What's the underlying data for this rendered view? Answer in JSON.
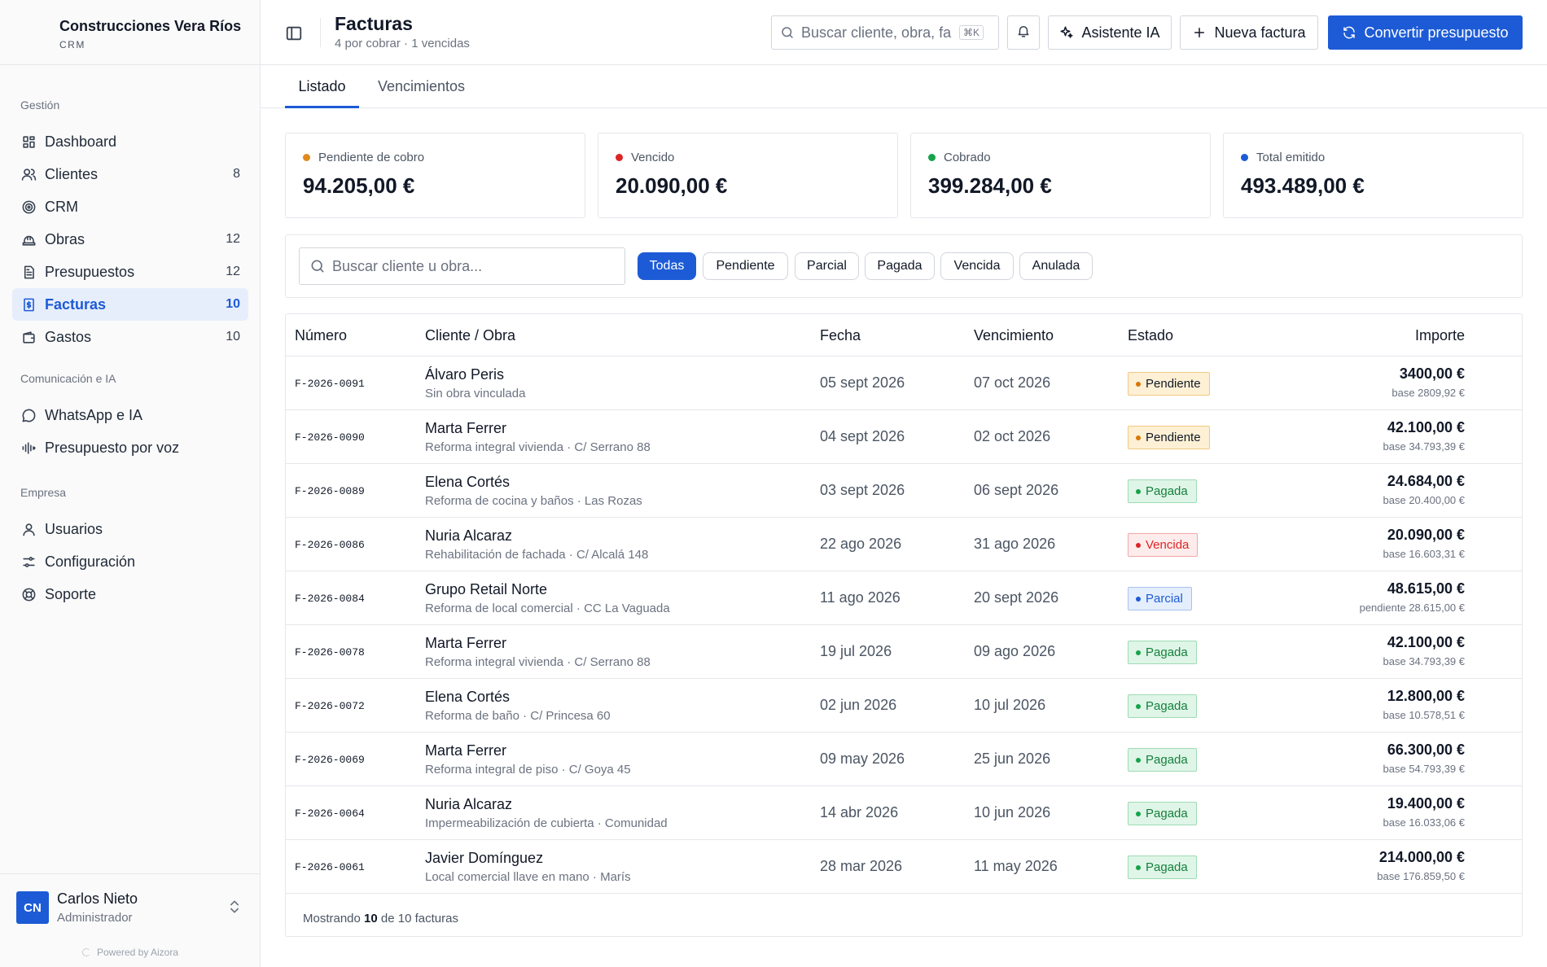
{
  "brand": {
    "name": "Construcciones Vera Ríos",
    "sub": "CRM"
  },
  "sidebar": {
    "groups": [
      {
        "title": "Gestión",
        "items": [
          {
            "label": "Dashboard",
            "icon": "dashboard-icon",
            "count": ""
          },
          {
            "label": "Clientes",
            "icon": "users-icon",
            "count": "8"
          },
          {
            "label": "CRM",
            "icon": "target-icon",
            "count": ""
          },
          {
            "label": "Obras",
            "icon": "helmet-icon",
            "count": "12"
          },
          {
            "label": "Presupuestos",
            "icon": "document-icon",
            "count": "12"
          },
          {
            "label": "Facturas",
            "icon": "invoice-icon",
            "count": "10",
            "active": true
          },
          {
            "label": "Gastos",
            "icon": "wallet-icon",
            "count": "10"
          }
        ]
      },
      {
        "title": "Comunicación e IA",
        "items": [
          {
            "label": "WhatsApp e IA",
            "icon": "chat-icon",
            "count": ""
          },
          {
            "label": "Presupuesto por voz",
            "icon": "waveform-icon",
            "count": ""
          }
        ]
      },
      {
        "title": "Empresa",
        "items": [
          {
            "label": "Usuarios",
            "icon": "user-icon",
            "count": ""
          },
          {
            "label": "Configuración",
            "icon": "sliders-icon",
            "count": ""
          },
          {
            "label": "Soporte",
            "icon": "lifebuoy-icon",
            "count": ""
          }
        ]
      }
    ]
  },
  "user": {
    "initials": "CN",
    "name": "Carlos Nieto",
    "role": "Administrador"
  },
  "powered_by": "Powered by Aizora",
  "header": {
    "title": "Facturas",
    "subtitle": "4 por cobrar · 1 vencidas",
    "search_placeholder": "Buscar cliente, obra, fa",
    "search_shortcut": "⌘K",
    "assistant_label": "Asistente IA",
    "new_invoice_label": "Nueva factura",
    "convert_label": "Convertir presupuesto"
  },
  "tabs": [
    {
      "label": "Listado",
      "active": true
    },
    {
      "label": "Vencimientos",
      "active": false
    }
  ],
  "stats": [
    {
      "label": "Pendiente de cobro",
      "value": "94.205,00 €",
      "color": "#e08a1e"
    },
    {
      "label": "Vencido",
      "value": "20.090,00 €",
      "color": "#dc2626"
    },
    {
      "label": "Cobrado",
      "value": "399.284,00 €",
      "color": "#16a34a"
    },
    {
      "label": "Total emitido",
      "value": "493.489,00 €",
      "color": "#1d5bd6"
    }
  ],
  "filters": {
    "search_placeholder": "Buscar cliente u obra...",
    "chips": [
      {
        "label": "Todas",
        "active": true
      },
      {
        "label": "Pendiente",
        "active": false
      },
      {
        "label": "Parcial",
        "active": false
      },
      {
        "label": "Pagada",
        "active": false
      },
      {
        "label": "Vencida",
        "active": false
      },
      {
        "label": "Anulada",
        "active": false
      }
    ]
  },
  "table": {
    "columns": [
      "Número",
      "Cliente / Obra",
      "Fecha",
      "Vencimiento",
      "Estado",
      "Importe"
    ],
    "rows": [
      {
        "number": "F-2026-0091",
        "client": "Álvaro Peris",
        "obra": "Sin obra vinculada",
        "date": "05 sept 2026",
        "due": "07 oct 2026",
        "status": "Pendiente",
        "status_key": "pendiente",
        "amount": "3400,00 €",
        "base": "base 2809,92 €"
      },
      {
        "number": "F-2026-0090",
        "client": "Marta Ferrer",
        "obra": "Reforma integral vivienda · C/ Serrano 88",
        "date": "04 sept 2026",
        "due": "02 oct 2026",
        "status": "Pendiente",
        "status_key": "pendiente",
        "amount": "42.100,00 €",
        "base": "base 34.793,39 €"
      },
      {
        "number": "F-2026-0089",
        "client": "Elena Cortés",
        "obra": "Reforma de cocina y baños · Las Rozas",
        "date": "03 sept 2026",
        "due": "06 sept 2026",
        "status": "Pagada",
        "status_key": "pagada",
        "amount": "24.684,00 €",
        "base": "base 20.400,00 €"
      },
      {
        "number": "F-2026-0086",
        "client": "Nuria Alcaraz",
        "obra": "Rehabilitación de fachada · C/ Alcalá 148",
        "date": "22 ago 2026",
        "due": "31 ago 2026",
        "status": "Vencida",
        "status_key": "vencida",
        "amount": "20.090,00 €",
        "base": "base 16.603,31 €"
      },
      {
        "number": "F-2026-0084",
        "client": "Grupo Retail Norte",
        "obra": "Reforma de local comercial · CC La Vaguada",
        "date": "11 ago 2026",
        "due": "20 sept 2026",
        "status": "Parcial",
        "status_key": "parcial",
        "amount": "48.615,00 €",
        "base": "pendiente 28.615,00 €"
      },
      {
        "number": "F-2026-0078",
        "client": "Marta Ferrer",
        "obra": "Reforma integral vivienda · C/ Serrano 88",
        "date": "19 jul 2026",
        "due": "09 ago 2026",
        "status": "Pagada",
        "status_key": "pagada",
        "amount": "42.100,00 €",
        "base": "base 34.793,39 €"
      },
      {
        "number": "F-2026-0072",
        "client": "Elena Cortés",
        "obra": "Reforma de baño · C/ Princesa 60",
        "date": "02 jun 2026",
        "due": "10 jul 2026",
        "status": "Pagada",
        "status_key": "pagada",
        "amount": "12.800,00 €",
        "base": "base 10.578,51 €"
      },
      {
        "number": "F-2026-0069",
        "client": "Marta Ferrer",
        "obra": "Reforma integral de piso · C/ Goya 45",
        "date": "09 may 2026",
        "due": "25 jun 2026",
        "status": "Pagada",
        "status_key": "pagada",
        "amount": "66.300,00 €",
        "base": "base 54.793,39 €"
      },
      {
        "number": "F-2026-0064",
        "client": "Nuria Alcaraz",
        "obra": "Impermeabilización de cubierta · Comunidad",
        "date": "14 abr 2026",
        "due": "10 jun 2026",
        "status": "Pagada",
        "status_key": "pagada",
        "amount": "19.400,00 €",
        "base": "base 16.033,06 €"
      },
      {
        "number": "F-2026-0061",
        "client": "Javier Domínguez",
        "obra": "Local comercial llave en mano · Marís",
        "date": "28 mar 2026",
        "due": "11 may 2026",
        "status": "Pagada",
        "status_key": "pagada",
        "amount": "214.000,00 €",
        "base": "base 176.859,50 €"
      }
    ],
    "footer": {
      "prefix": "Mostrando",
      "shown": "10",
      "middle": "de 10 facturas"
    }
  }
}
